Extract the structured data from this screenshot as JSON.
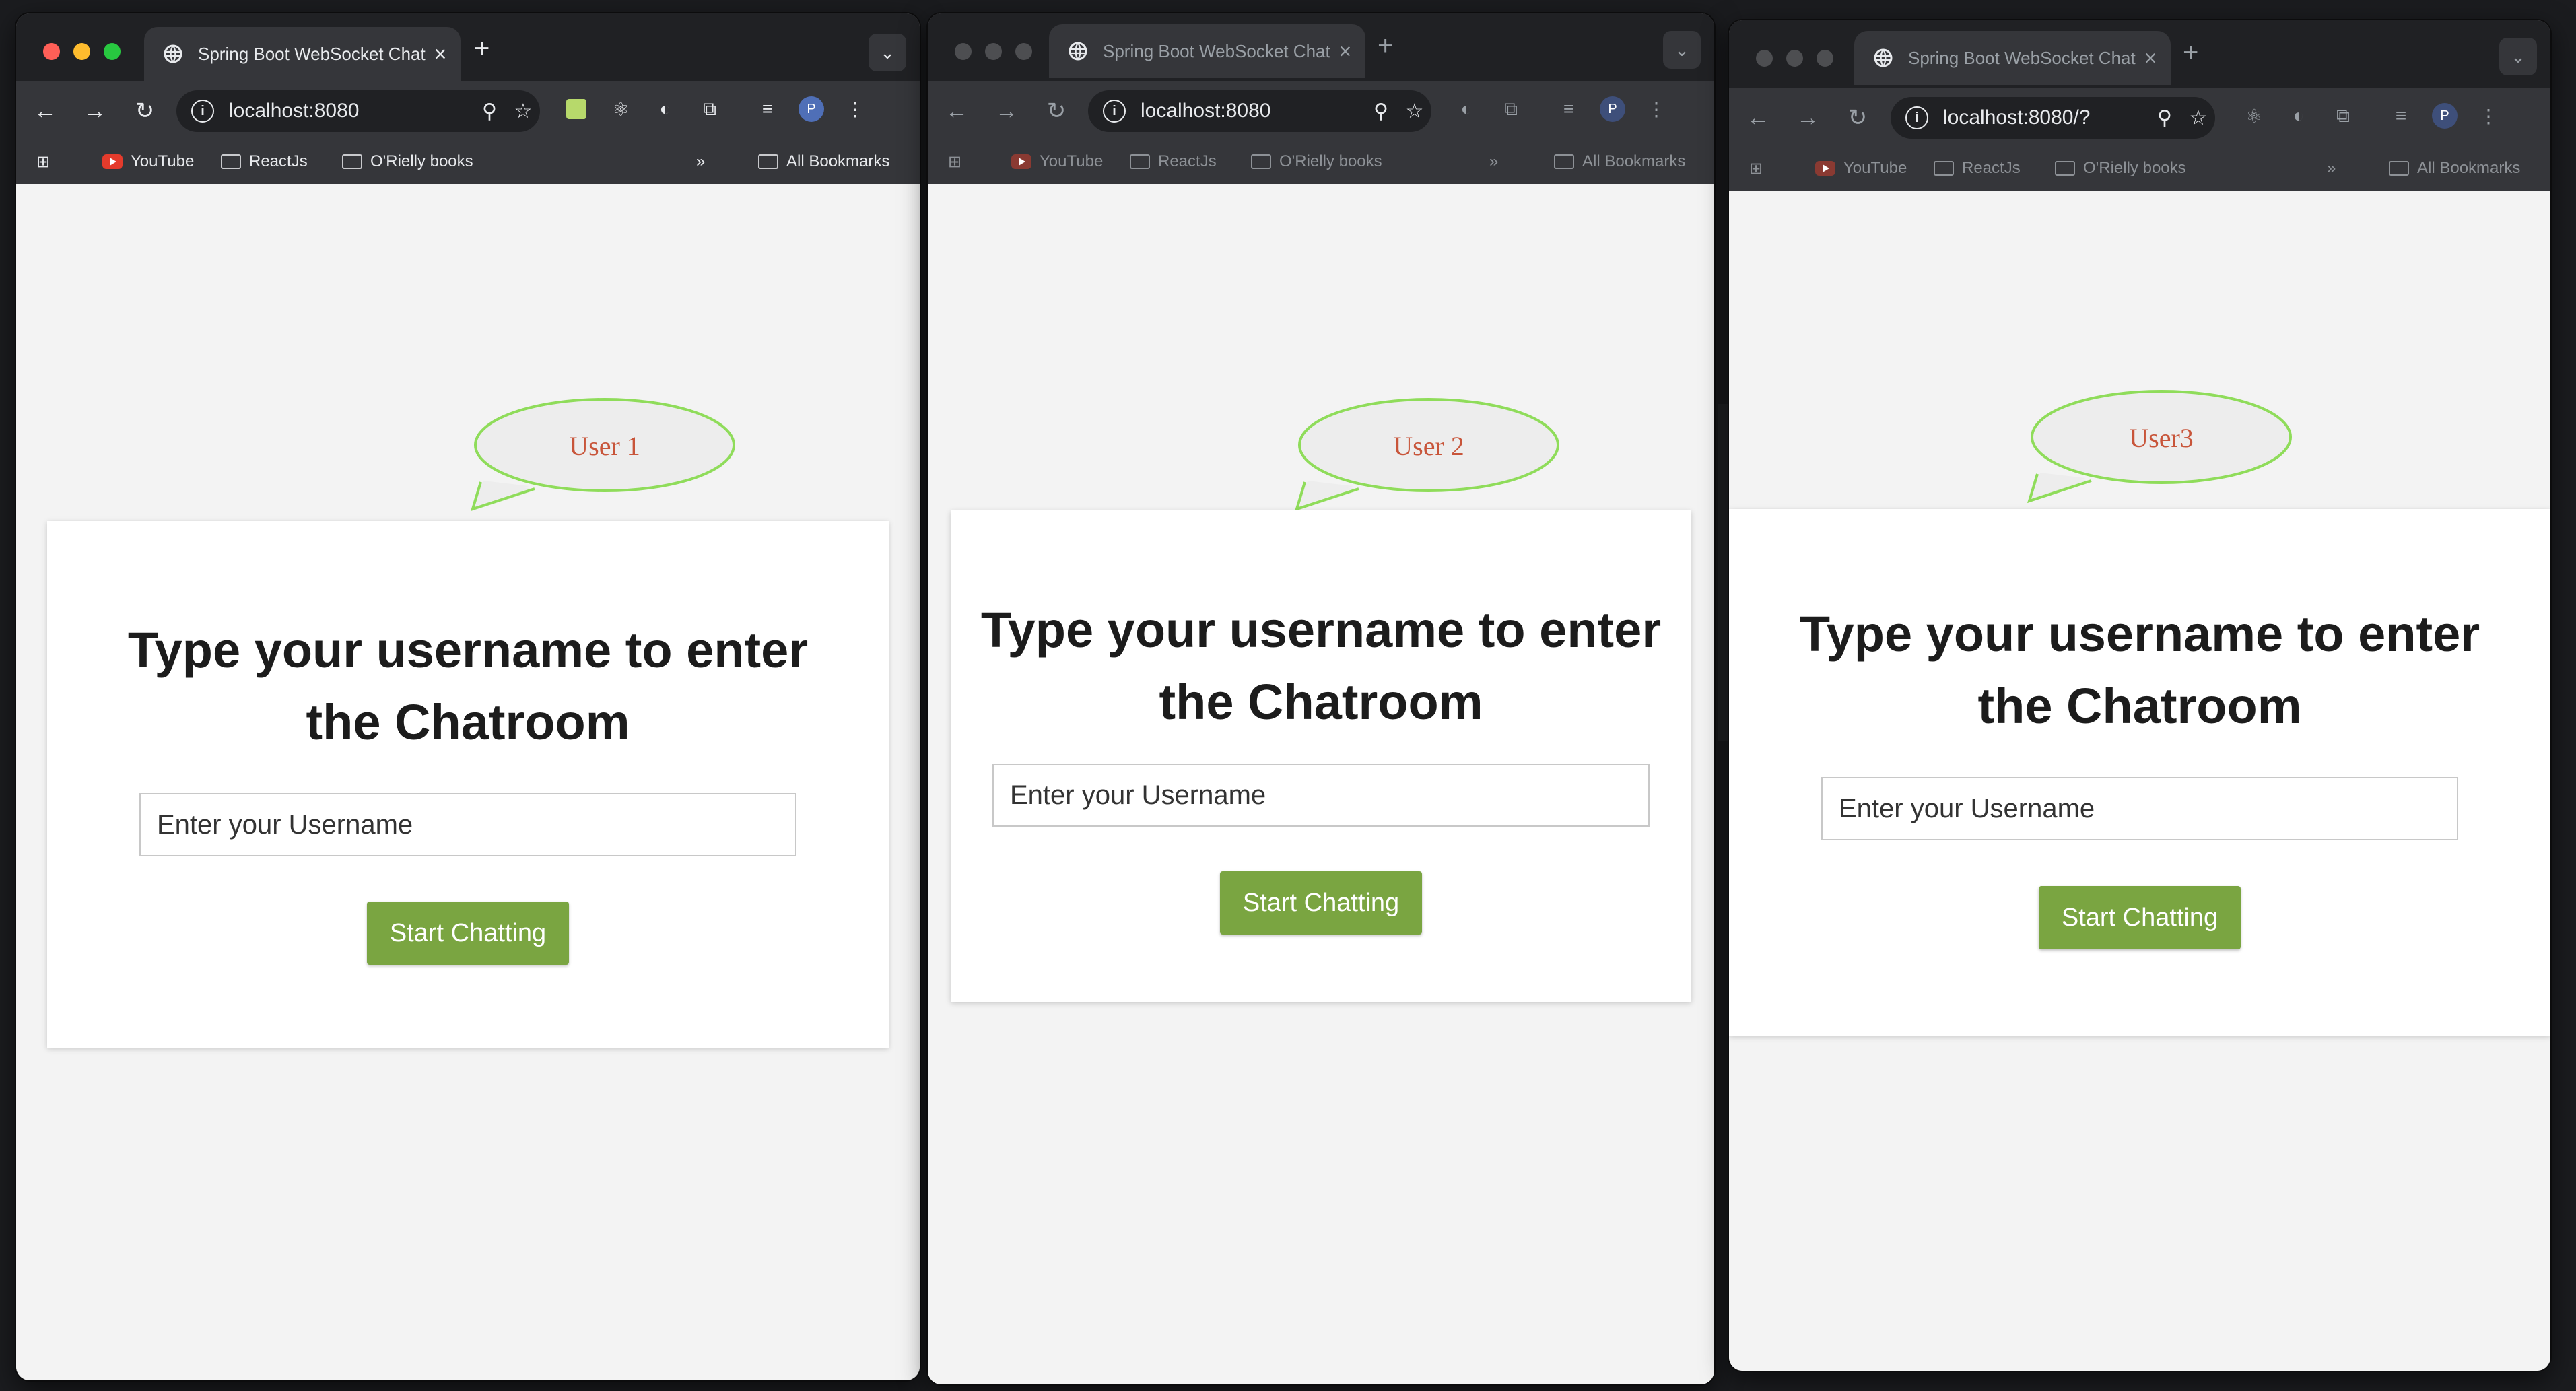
{
  "tab": {
    "title": "Spring Boot WebSocket Chat",
    "close": "×",
    "new_tab": "+"
  },
  "nav": {
    "back": "←",
    "forward": "→",
    "reload": "↻",
    "tab_search": "⌄"
  },
  "bookmarks": {
    "items": [
      "YouTube",
      "ReactJs",
      "O'Rielly books"
    ],
    "overflow": "»",
    "all_bookmarks": "All Bookmarks"
  },
  "windows": [
    {
      "url": "localhost:8080",
      "callout": "User 1"
    },
    {
      "url": "localhost:8080",
      "callout": "User 2"
    },
    {
      "url": "localhost:8080/?",
      "callout": "User3"
    }
  ],
  "login": {
    "heading_line1": "Type your username to enter",
    "heading_line2": "the Chatroom",
    "placeholder": "Enter your Username",
    "button": "Start Chatting"
  },
  "profile_initial": "P",
  "colors": {
    "accent_button": "#7aa541",
    "callout_text": "#c8553a",
    "callout_outline": "#8fdc5a"
  }
}
